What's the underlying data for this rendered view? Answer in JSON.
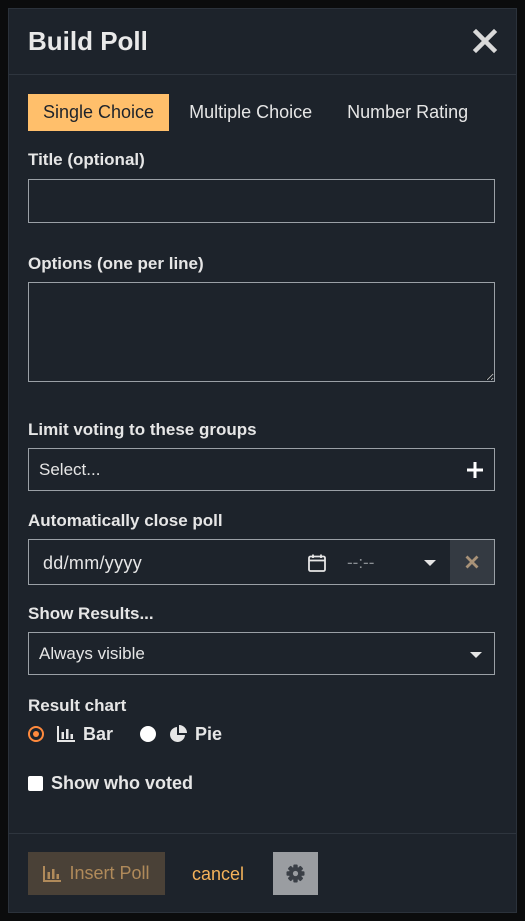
{
  "header": {
    "title": "Build Poll"
  },
  "tabs": [
    {
      "label": "Single Choice",
      "active": true
    },
    {
      "label": "Multiple Choice",
      "active": false
    },
    {
      "label": "Number Rating",
      "active": false
    }
  ],
  "form": {
    "title_label": "Title (optional)",
    "title_value": "",
    "options_label": "Options (one per line)",
    "options_value": "",
    "groups_label": "Limit voting to these groups",
    "groups_placeholder": "Select...",
    "close_label": "Automatically close poll",
    "date_placeholder": "dd/mm/yyyy",
    "time_placeholder": "--:--",
    "results_label": "Show Results...",
    "results_value": "Always visible",
    "chart_label": "Result chart",
    "chart_options": [
      {
        "label": "Bar",
        "selected": true,
        "icon": "bar-chart-icon"
      },
      {
        "label": "Pie",
        "selected": false,
        "icon": "pie-chart-icon"
      }
    ],
    "show_voters_label": "Show who voted",
    "show_voters_checked": false
  },
  "footer": {
    "insert_label": "Insert Poll",
    "cancel_label": "cancel",
    "settings_icon": "gear-icon"
  },
  "colors": {
    "accent": "#ffbf6b",
    "radio_selected": "#ff8a3d",
    "link": "#f4b25a",
    "background": "#1d232b"
  }
}
